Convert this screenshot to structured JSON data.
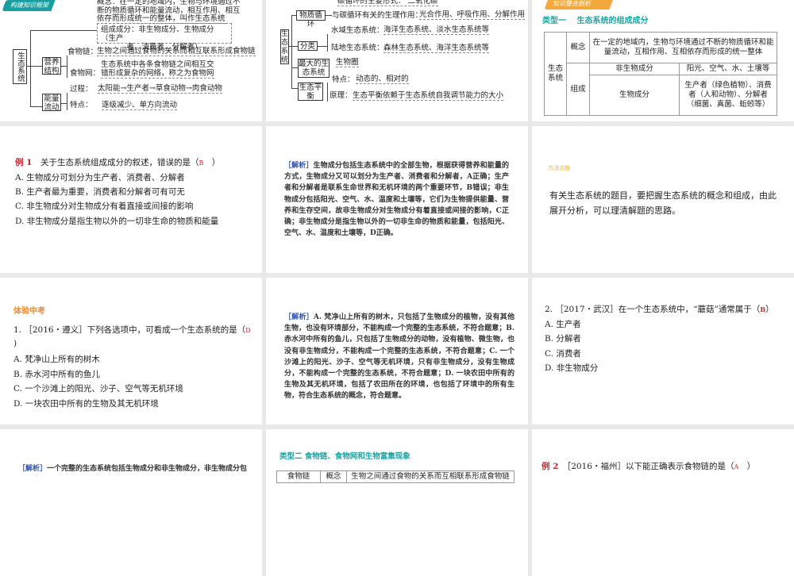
{
  "slide1": {
    "banner": "构建知识框架",
    "concept": [
      "概念：在一定的地域内，生物与环境通过不",
      "断的物质循环和能量流动，相互作用、相互",
      "依存而形成统一的整体，叫作生态系统"
    ],
    "composition": [
      "组成成分：非生物成分、生物成分（生产",
      "者、消费者、分解者）"
    ],
    "root": "生态系统",
    "nutrition": "营养结构",
    "energy": "能量流动",
    "food_chain_label": "食物链：",
    "food_chain_text": "生物之间通过食物的关系而相互联系形成食物链",
    "food_web_label": "食物网：",
    "food_web_text": [
      "生态系统中各条食物链之间相互交",
      "错形成复杂的网络，称之为食物网"
    ],
    "process_label": "过程：",
    "process_text": "太阳能→生产者→草食动物→肉食动物",
    "feature_label": "特点：",
    "feature_text": "逐级减少、单方向流动"
  },
  "slide2": {
    "carbon_form": "碳循环的主要形式：    二氧化碳",
    "root": "生态系统",
    "matter": "物质循环",
    "carbon_label": "与碳循环有关的生理作用：",
    "carbon_text": "光合作用、呼吸作用、分解作用",
    "classify": "分类",
    "water_label": "水域生态系统：",
    "water_text": "海洋生态系统、淡水生态系统等",
    "land_label": "陆地生态系统：",
    "land_text": "森林生态系统、海洋生态系统等",
    "largest": "最大的生态系统",
    "biosphere": "生物圈",
    "balance": "生态平衡",
    "bal_feature_label": "特点：",
    "bal_feature_text": "动态的、相对的",
    "principle_label": "原理：",
    "principle_text": "生态平衡依赖于生态系统自我调节能力的大小"
  },
  "slide3": {
    "banner": "知识整合剖析",
    "heading": "类型一　 生态系统的组成成分",
    "table": {
      "root": "生态系统",
      "concept_label": "概念",
      "concept_text": "在一定的地域内，生物与环境通过不断的物质循环和能量流动，互相作用、互相依存而形成的统一整体",
      "comp_label": "组成",
      "abiotic": "非生物成分",
      "abiotic_text": "阳光、空气、水、土壤等",
      "biotic": "生物成分",
      "biotic_text": "生产者（绿色植物）、消费者（人和动物）、分解者（细菌、真菌、蚯蚓等）"
    }
  },
  "slide4": {
    "tag": "例 1",
    "question": "　关于生态系统组成成分的叙述，错误的是（",
    "answer": "B",
    "close": "　）",
    "options": [
      "A. 生物成分可划分为生产者、消费者、分解者",
      "B. 生产者最为重要，消费者和分解者可有可无",
      "C. 非生物成分对生物成分有着直接或间接的影响",
      "D. 非生物成分是指生物以外的一切非生命的物质和能量"
    ]
  },
  "slide5": {
    "tag": "［解析］",
    "text": "生物成分包括生态系统中的全部生物，根据获得营养和能量的方式，生物成分又可以划分为生产者、消费者和分解者，A正确；生产者和分解者是联系生命世界和无机环境的两个重要环节，B错误；非生物成分包括阳光、空气、水、温度和土壤等，它们为生物提供能量、营养和生存空间，故非生物成分对生物成分有着直接或间接的影响，C正确；非生物成分是指生物以外的一切非生命的物质和能量，包括阳光、空气、水、温度和土壤等，D正确。"
  },
  "slide6": {
    "title": "方法点拨",
    "text": "有关生态系统的题目，要把握生态系统的概念和组成，由此展开分析，可以理清解题的思路。"
  },
  "slide7": {
    "title": "体验中考",
    "question": "1. ［2016・遵义］下列各选项中，可看成一个生态系统的是（",
    "answer": "D",
    "close": ")",
    "options": [
      "A. 梵净山上所有的树木",
      "B. 赤水河中所有的鱼儿",
      "C. 一个沙滩上的阳光、沙子、空气等无机环境",
      "D. 一块农田中所有的生物及其无机环境"
    ]
  },
  "slide8": {
    "tag": "［解析］",
    "text": "A. 梵净山上所有的树木，只包括了生物成分的植物，没有其他生物，也没有环境部分，不能构成一个完整的生态系统，不符合题意；B. 赤水河中所有的鱼儿，只包括了生物成分的动物，没有植物、微生物，也没有非生物成分，不能构成一个完整的生态系统，不符合题意；C. 一个沙滩上的阳光、沙子、空气等无机环境，只有非生物成分，没有生物成分，不能构成一个完整的生态系统，不符合题意；D. 一块农田中所有的生物及其无机环境，包括了农田所在的环境，也包括了环境中的所有生物，符合生态系统的概念，符合题意。"
  },
  "slide9": {
    "question": "2. ［2017・武汉］在一个生态系统中，“蘑菇”通常属于（",
    "answer": "B",
    "close": "）",
    "options": [
      "A. 生产者",
      "B. 分解者",
      "C. 消费者",
      "D. 非生物成分"
    ]
  },
  "slide10": {
    "tag": "［解析］",
    "text": "一个完整的生态系统包括生物成分和非生物成分，非生物成分包"
  },
  "slide11": {
    "heading": "类型二  食物链、食物网和生物富集现象",
    "c1": "食物链",
    "c2": "概念",
    "c3": "生物之间通过食物的关系而互相联系形成食物链"
  },
  "slide12": {
    "tag": "例 2",
    "question": "［2016・福州］以下能正确表示食物链的是（",
    "answer": "A",
    "close": "　）"
  }
}
